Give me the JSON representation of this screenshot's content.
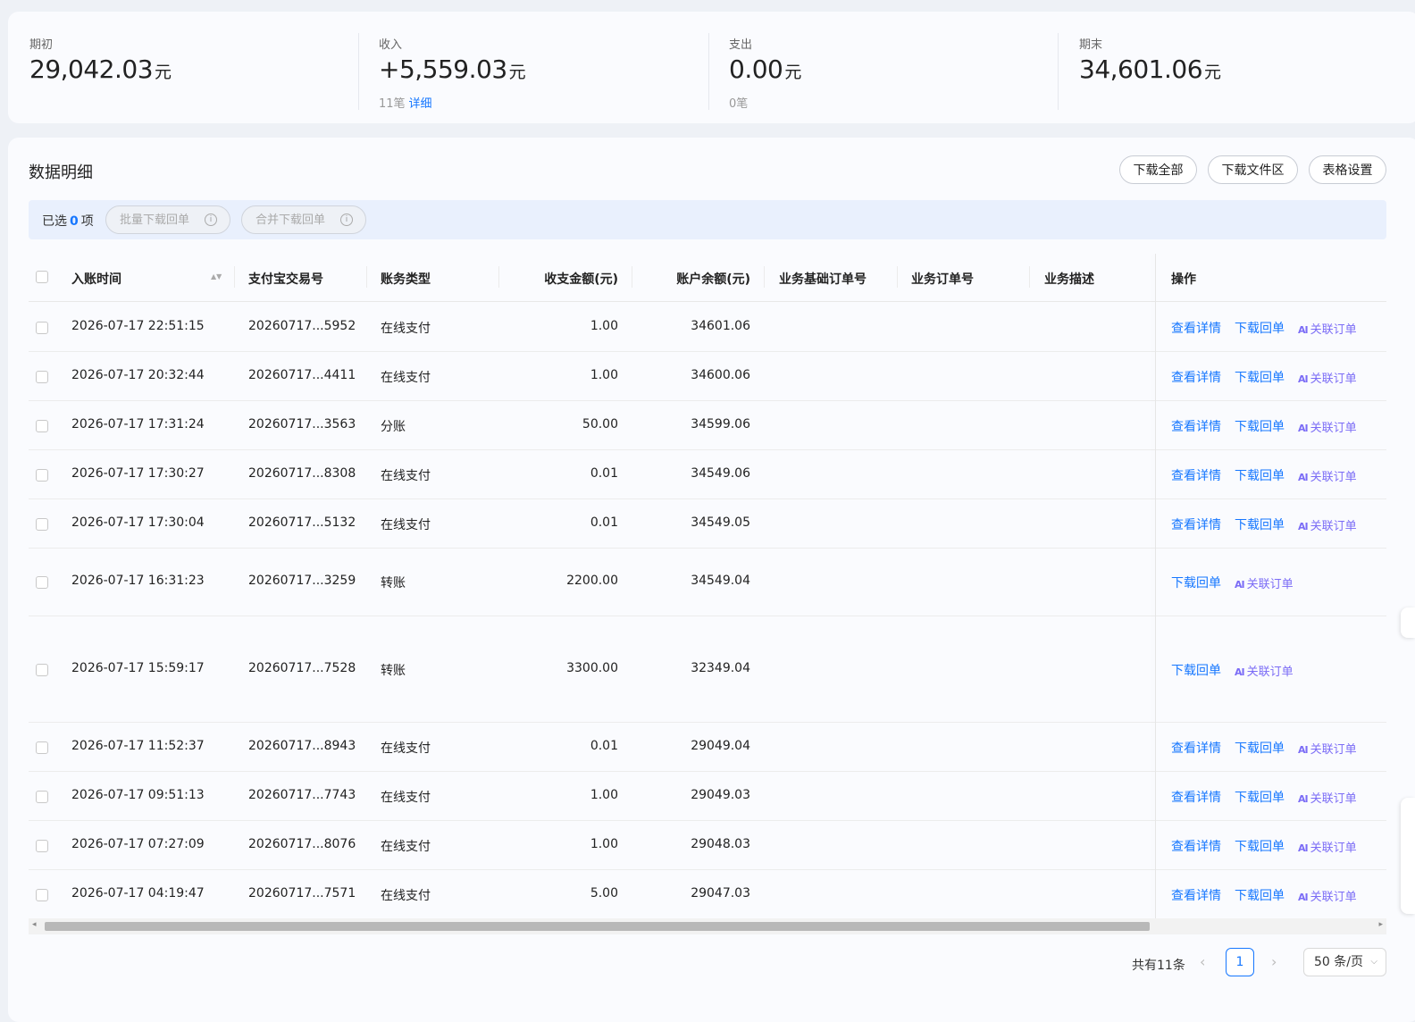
{
  "summary": {
    "opening": {
      "label": "期初",
      "amount": "29,042.03",
      "unit": "元"
    },
    "income": {
      "label": "收入",
      "amount": "+5,559.03",
      "unit": "元",
      "count": "11笔",
      "detail_link": "详细"
    },
    "expense": {
      "label": "支出",
      "amount": "0.00",
      "unit": "元",
      "count": "0笔"
    },
    "closing": {
      "label": "期末",
      "amount": "34,601.06",
      "unit": "元"
    }
  },
  "section": {
    "title": "数据明细",
    "buttons": {
      "download_all": "下载全部",
      "download_area": "下载文件区",
      "table_settings": "表格设置"
    }
  },
  "selection": {
    "prefix": "已选",
    "count": "0",
    "suffix": "项",
    "batch_download": "批量下载回单",
    "merge_download": "合并下载回单",
    "info_glyph": "i"
  },
  "table": {
    "columns": {
      "time": "入账时间",
      "trade_no": "支付宝交易号",
      "type": "账务类型",
      "amount": "收支金额(元)",
      "balance": "账户余额(元)",
      "base_order": "业务基础订单号",
      "order": "业务订单号",
      "desc": "业务描述",
      "ops": "操作"
    },
    "actions": {
      "view": "查看详情",
      "download": "下载回单",
      "link": "关联订单",
      "link_icon": "AI"
    },
    "rows": [
      {
        "time": "2026-07-17 22:51:15",
        "trade_no": "20260717...5952",
        "type": "在线支付",
        "amount": "1.00",
        "balance": "34601.06",
        "ops": [
          "view",
          "download",
          "link"
        ]
      },
      {
        "time": "2026-07-17 20:32:44",
        "trade_no": "20260717...4411",
        "type": "在线支付",
        "amount": "1.00",
        "balance": "34600.06",
        "ops": [
          "view",
          "download",
          "link"
        ]
      },
      {
        "time": "2026-07-17 17:31:24",
        "trade_no": "20260717...3563",
        "type": "分账",
        "amount": "50.00",
        "balance": "34599.06",
        "ops": [
          "view",
          "download",
          "link"
        ]
      },
      {
        "time": "2026-07-17 17:30:27",
        "trade_no": "20260717...8308",
        "type": "在线支付",
        "amount": "0.01",
        "balance": "34549.06",
        "ops": [
          "view",
          "download",
          "link"
        ]
      },
      {
        "time": "2026-07-17 17:30:04",
        "trade_no": "20260717...5132",
        "type": "在线支付",
        "amount": "0.01",
        "balance": "34549.05",
        "ops": [
          "view",
          "download",
          "link"
        ]
      },
      {
        "time": "2026-07-17 16:31:23",
        "trade_no": "20260717...3259",
        "type": "转账",
        "amount": "2200.00",
        "balance": "34549.04",
        "ops": [
          "download",
          "link"
        ]
      },
      {
        "time": "2026-07-17 15:59:17",
        "trade_no": "20260717...7528",
        "type": "转账",
        "amount": "3300.00",
        "balance": "32349.04",
        "ops": [
          "download",
          "link"
        ]
      },
      {
        "time": "2026-07-17 11:52:37",
        "trade_no": "20260717...8943",
        "type": "在线支付",
        "amount": "0.01",
        "balance": "29049.04",
        "ops": [
          "view",
          "download",
          "link"
        ]
      },
      {
        "time": "2026-07-17 09:51:13",
        "trade_no": "20260717...7743",
        "type": "在线支付",
        "amount": "1.00",
        "balance": "29049.03",
        "ops": [
          "view",
          "download",
          "link"
        ]
      },
      {
        "time": "2026-07-17 07:27:09",
        "trade_no": "20260717...8076",
        "type": "在线支付",
        "amount": "1.00",
        "balance": "29048.03",
        "ops": [
          "view",
          "download",
          "link"
        ]
      },
      {
        "time": "2026-07-17 04:19:47",
        "trade_no": "20260717...7571",
        "type": "在线支付",
        "amount": "5.00",
        "balance": "29047.03",
        "ops": [
          "view",
          "download",
          "link"
        ]
      }
    ]
  },
  "pagination": {
    "total_text": "共有11条",
    "current_page": "1",
    "page_size": "50 条/页",
    "prev_glyph": "‹",
    "next_glyph": "›",
    "size_chevron": "⌵"
  },
  "scrollbar": {
    "left_glyph": "◂",
    "right_glyph": "▸"
  },
  "sort_glyph": "▲▼"
}
